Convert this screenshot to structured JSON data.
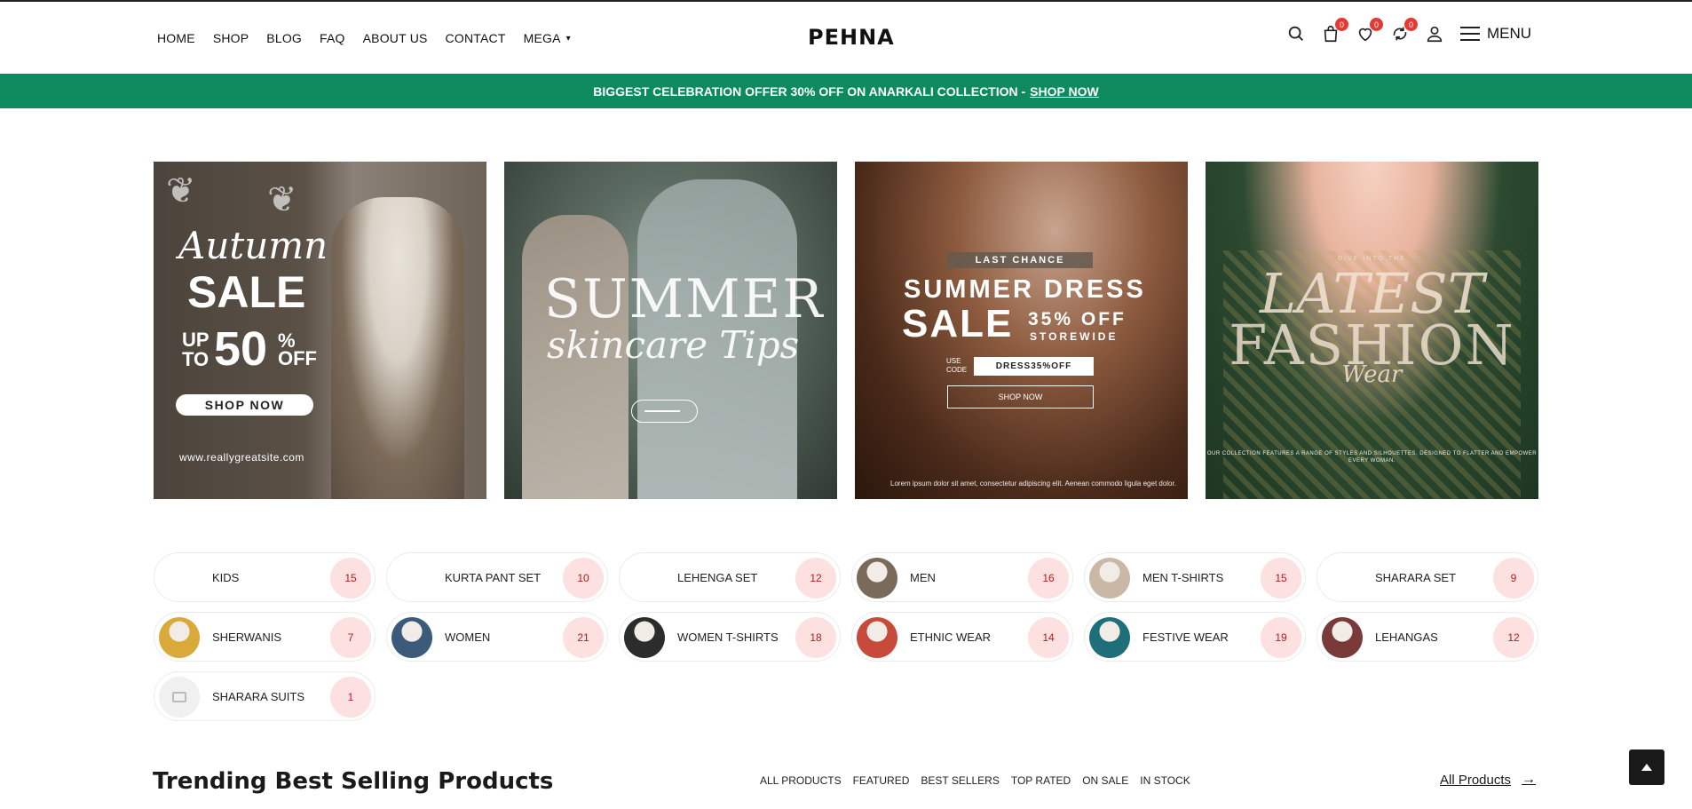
{
  "header": {
    "nav": [
      {
        "label": "HOME"
      },
      {
        "label": "SHOP"
      },
      {
        "label": "BLOG"
      },
      {
        "label": "FAQ"
      },
      {
        "label": "ABOUT US"
      },
      {
        "label": "CONTACT"
      },
      {
        "label": "MEGA"
      }
    ],
    "logo": "PEHNA",
    "cart_count": "0",
    "wishlist_count": "0",
    "compare_count": "0",
    "menu_label": "MENU"
  },
  "promo": {
    "text": "BIGGEST CELEBRATION OFFER 30% OFF ON ANARKALI COLLECTION -",
    "link": "SHOP NOW"
  },
  "banners": {
    "b1": {
      "script": "Autumn",
      "sale": "SALE",
      "up": "UP",
      "to": "TO",
      "percent": "50",
      "pct_sign": "%",
      "off": "OFF",
      "button": "SHOP NOW",
      "site": "www.reallygreatsite.com"
    },
    "b2": {
      "line1": "SUMMER",
      "line2": "skincare Tips"
    },
    "b3": {
      "tag": "LAST CHANCE",
      "line1": "SUMMER DRESS",
      "sale": "SALE",
      "pct": "35% OFF",
      "storewide": "STOREWIDE",
      "use": "USE",
      "code_label": "CODE",
      "code": "DRESS35%OFF",
      "button": "SHOP NOW",
      "lorem": "Lorem ipsum dolor sit amet, consectetur adipiscing elit. Aenean commodo ligula eget dolor."
    },
    "b4": {
      "dive": "DIVE INTO THE",
      "line1": "LATEST",
      "line2": "FASHION",
      "line3": "Wear",
      "small": "OUR COLLECTION FEATURES A RANGE OF STYLES AND SILHOUETTES, DESIGNED TO FLATTER AND EMPOWER EVERY WOMAN."
    }
  },
  "categories": [
    {
      "name": "KIDS",
      "count": "15",
      "thumb": "none"
    },
    {
      "name": "KURTA PANT SET",
      "count": "10",
      "thumb": "none"
    },
    {
      "name": "LEHENGA SET",
      "count": "12",
      "thumb": "none"
    },
    {
      "name": "MEN",
      "count": "16",
      "thumb": "img",
      "color": "#7a6a5a"
    },
    {
      "name": "MEN T-SHIRTS",
      "count": "15",
      "thumb": "img",
      "color": "#c9b8a6"
    },
    {
      "name": "SHARARA SET",
      "count": "9",
      "thumb": "none"
    },
    {
      "name": "SHERWANIS",
      "count": "7",
      "thumb": "img",
      "color": "#d9a93a"
    },
    {
      "name": "WOMEN",
      "count": "21",
      "thumb": "img",
      "color": "#3c5a7a"
    },
    {
      "name": "WOMEN T-SHIRTS",
      "count": "18",
      "thumb": "img",
      "color": "#2c2c2c"
    },
    {
      "name": "ETHNIC WEAR",
      "count": "14",
      "thumb": "img",
      "color": "#c84a3a"
    },
    {
      "name": "FESTIVE WEAR",
      "count": "19",
      "thumb": "img",
      "color": "#1f6f7a"
    },
    {
      "name": "LEHANGAS",
      "count": "12",
      "thumb": "img",
      "color": "#7a3a3a"
    },
    {
      "name": "SHARARA SUITS",
      "count": "1",
      "thumb": "placeholder"
    }
  ],
  "trending": {
    "title": "Trending Best Selling Products",
    "filters": [
      "ALL PRODUCTS",
      "FEATURED",
      "BEST SELLERS",
      "TOP RATED",
      "ON SALE",
      "IN STOCK"
    ],
    "all_products": "All Products"
  },
  "colors": {
    "promo_bg": "#0e8a5f",
    "badge": "#e53935",
    "count_bg": "#fde0e0",
    "count_text": "#b71c1c"
  }
}
